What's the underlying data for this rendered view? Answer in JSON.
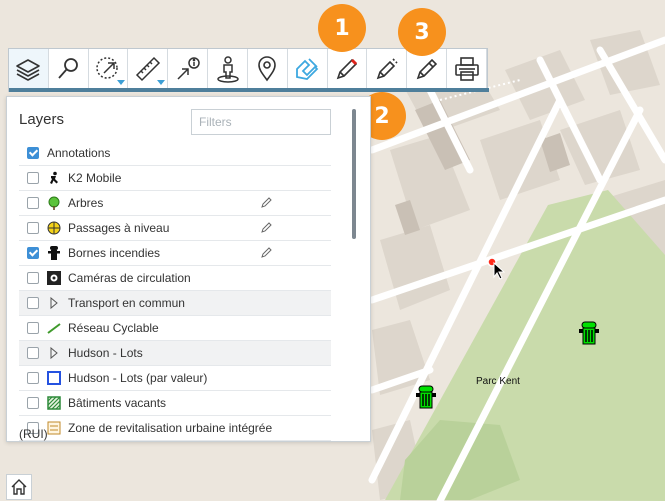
{
  "toolbar": {
    "tools": [
      {
        "name": "layers",
        "icon": "layers-icon"
      },
      {
        "name": "search",
        "icon": "search-icon"
      },
      {
        "name": "select-area",
        "icon": "select-area-icon"
      },
      {
        "name": "measure",
        "icon": "ruler-icon"
      },
      {
        "name": "identify",
        "icon": "info-pointer-icon"
      },
      {
        "name": "street-view",
        "icon": "person-icon"
      },
      {
        "name": "locate",
        "icon": "map-pin-icon"
      },
      {
        "name": "redline",
        "icon": "tape-icon"
      },
      {
        "name": "draw-1",
        "icon": "pencil-icon"
      },
      {
        "name": "draw-2",
        "icon": "pencil-icon"
      },
      {
        "name": "draw-3",
        "icon": "pencil-icon"
      },
      {
        "name": "print",
        "icon": "printer-icon"
      }
    ],
    "accent_color": "#4f7f9b"
  },
  "badges": [
    {
      "label": "1",
      "color": "#f7911d"
    },
    {
      "label": "2",
      "color": "#f7911d"
    },
    {
      "label": "3",
      "color": "#f7911d"
    }
  ],
  "layers_panel": {
    "title": "Layers",
    "filter_placeholder": "Filters",
    "items": [
      {
        "label": "Annotations",
        "checked": true,
        "icon": ""
      },
      {
        "label": "K2 Mobile",
        "checked": false,
        "icon": "runner-icon"
      },
      {
        "label": "Arbres",
        "checked": false,
        "icon": "tree-icon",
        "editable": true
      },
      {
        "label": "Passages à niveau",
        "checked": false,
        "icon": "crossing-icon",
        "editable": true
      },
      {
        "label": "Bornes incendies",
        "checked": true,
        "icon": "hydrant-icon",
        "editable": true
      },
      {
        "label": "Caméras de circulation",
        "checked": false,
        "icon": "camera-icon"
      },
      {
        "label": "Transport en commun",
        "checked": false,
        "icon": "chevron-right-icon"
      },
      {
        "label": "Réseau Cyclable",
        "checked": false,
        "icon": "line-icon"
      },
      {
        "label": "Hudson - Lots",
        "checked": false,
        "icon": "chevron-right-icon"
      },
      {
        "label": "Hudson - Lots (par valeur)",
        "checked": false,
        "icon": "square-outline-icon"
      },
      {
        "label": "Bâtiments vacants",
        "checked": false,
        "icon": "hatched-square-icon"
      },
      {
        "label": "Zone de revitalisation urbaine intégrée",
        "checked": false,
        "icon": "stack-icon"
      }
    ],
    "overflow_text": "(RUI)"
  },
  "map": {
    "park_label": "Parc Kent",
    "park_color": "#c9dbab",
    "background_color": "#ece6dd"
  },
  "home_button": {
    "icon": "home-icon"
  }
}
